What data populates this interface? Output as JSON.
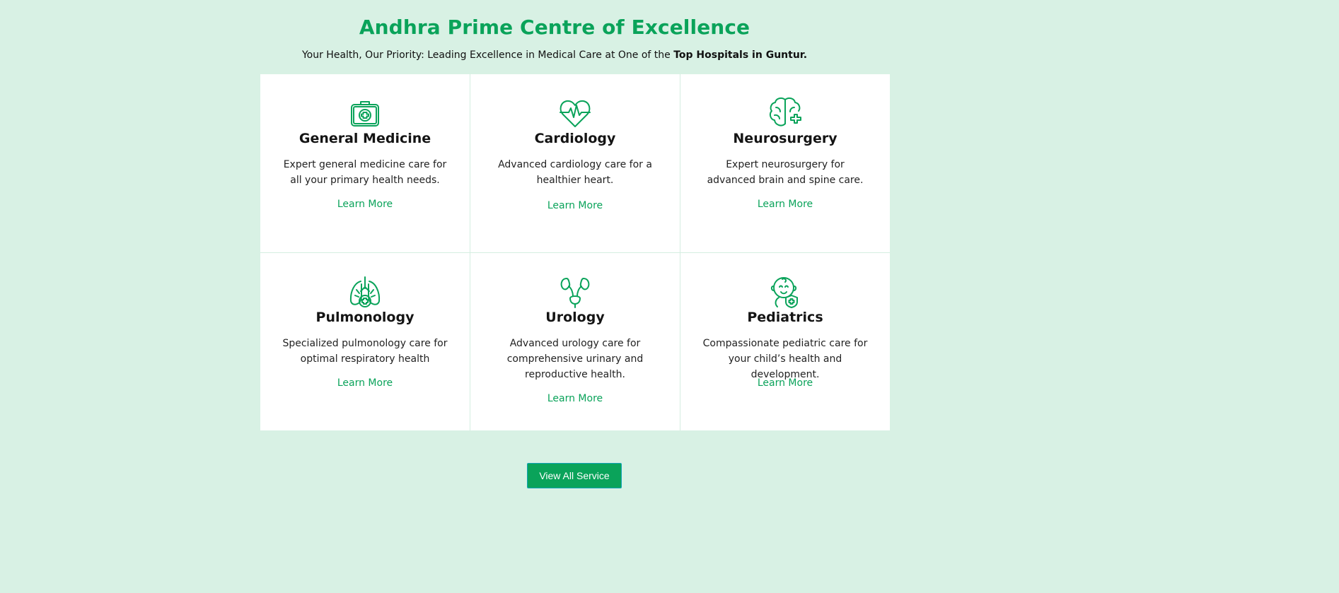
{
  "section": {
    "title": "Andhra Prime Centre of Excellence",
    "subtitle_plain": "Your Health, Our Priority: Leading Excellence in Medical Care at One of the ",
    "subtitle_bold": "Top Hospitals in Guntur."
  },
  "cards": [
    {
      "title": "General Medicine",
      "desc": "Expert general medicine care for all your primary health needs.",
      "link": "Learn More",
      "icon": "medical-kit-icon"
    },
    {
      "title": "Cardiology",
      "desc": "Advanced cardiology care for a healthier heart.",
      "link": "Learn More",
      "icon": "heart-pulse-icon"
    },
    {
      "title": "Neurosurgery",
      "desc": "Expert neurosurgery for advanced brain and spine care.",
      "link": "Learn More",
      "icon": "brain-plus-icon"
    },
    {
      "title": "Pulmonology",
      "desc": "Specialized pulmonology care for optimal respiratory health",
      "link": "Learn More",
      "icon": "lungs-icon"
    },
    {
      "title": "Urology",
      "desc": "Advanced urology care for comprehensive urinary and reproductive health.",
      "link": "Learn More",
      "icon": "kidneys-icon"
    },
    {
      "title": "Pediatrics",
      "desc": "Compassionate pediatric care for your child’s health and development.",
      "link": "Learn More",
      "icon": "baby-shield-icon"
    }
  ],
  "cta": {
    "label": "View All Service"
  },
  "colors": {
    "accent": "#0aa35a",
    "background": "#d8f1e4",
    "card": "#ffffff"
  }
}
